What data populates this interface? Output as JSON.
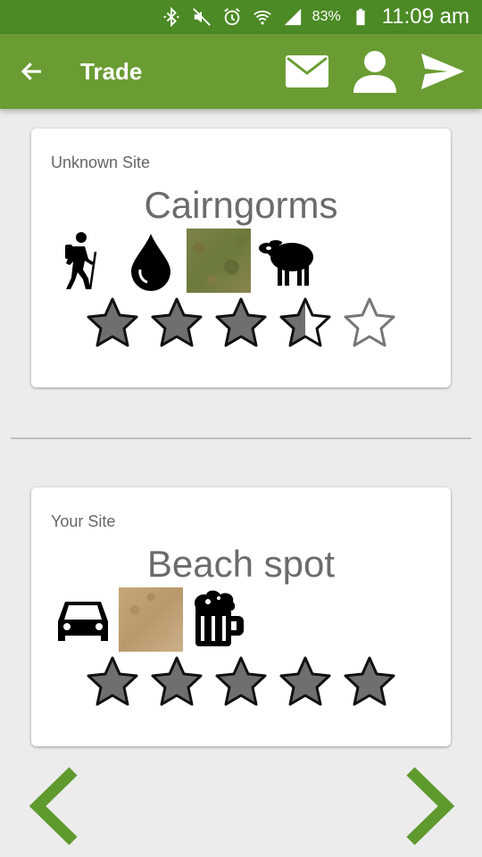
{
  "status_bar": {
    "battery_percent": "83%",
    "time": "11:09 am",
    "icons": [
      "bluetooth-icon",
      "mute-icon",
      "alarm-icon",
      "wifi-icon",
      "signal-icon",
      "battery-icon"
    ]
  },
  "app_bar": {
    "title": "Trade",
    "actions": [
      "mail-icon",
      "person-icon",
      "send-icon"
    ],
    "color": "#6a9c33"
  },
  "cards": [
    {
      "label": "Unknown Site",
      "title": "Cairngorms",
      "features": [
        "hiking-icon",
        "water-drop-icon",
        "grass-swatch",
        "sheep-icon"
      ],
      "rating": 3.5,
      "rating_max": 5
    },
    {
      "label": "Your Site",
      "title": "Beach spot",
      "features": [
        "car-icon",
        "sand-swatch",
        "beer-icon"
      ],
      "rating": 5,
      "rating_max": 5
    }
  ],
  "navigation": {
    "prev": "chevron-left-icon",
    "next": "chevron-right-icon",
    "color": "#5f9a2e"
  }
}
